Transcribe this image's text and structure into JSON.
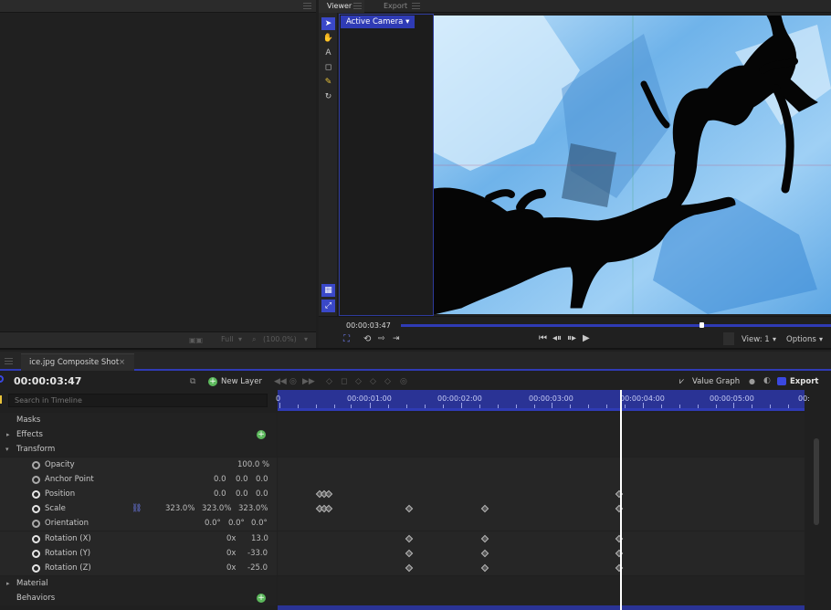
{
  "viewer": {
    "tabs": [
      "Viewer",
      "Export"
    ],
    "camera_label": "Active Camera",
    "timecode": "00:00:03:47",
    "view_label": "View: 1",
    "options_label": "Options"
  },
  "left_panel": {
    "zoom_mode": "Full",
    "zoom_value": "(100.0%)"
  },
  "composite": {
    "tab_label": "ice.jpg Composite Shot",
    "timecode": "00:00:03:47",
    "new_layer_label": "New Layer",
    "value_graph_label": "Value Graph",
    "export_label": "Export",
    "search_placeholder": "Search in Timeline"
  },
  "ruler": {
    "labels": [
      "0",
      "00:00:01:00",
      "00:00:02:00",
      "00:00:03:00",
      "00:00:04:00",
      "00:00:05:00",
      "00:"
    ]
  },
  "tree": {
    "masks": "Masks",
    "effects": "Effects",
    "transform": "Transform",
    "material": "Material",
    "behaviors": "Behaviors"
  },
  "properties": [
    {
      "name": "Opacity",
      "values": [
        "100.0 %"
      ]
    },
    {
      "name": "Anchor Point",
      "values": [
        "0.0",
        "0.0",
        "0.0"
      ]
    },
    {
      "name": "Position",
      "values": [
        "0.0",
        "0.0",
        "0.0"
      ]
    },
    {
      "name": "Scale",
      "values": [
        "323.0%",
        "323.0%",
        "323.0%"
      ]
    },
    {
      "name": "Orientation",
      "values": [
        "0.0°",
        "0.0°",
        "0.0°"
      ]
    },
    {
      "name": "Rotation (X)",
      "values": [
        "0x",
        "13.0"
      ]
    },
    {
      "name": "Rotation (Y)",
      "values": [
        "0x",
        "-33.0"
      ]
    },
    {
      "name": "Rotation (Z)",
      "values": [
        "0x",
        "-25.0"
      ]
    }
  ],
  "colors": {
    "accent": "#2f3bb5",
    "panel": "#202020",
    "keyframe_fill": "#555555"
  }
}
